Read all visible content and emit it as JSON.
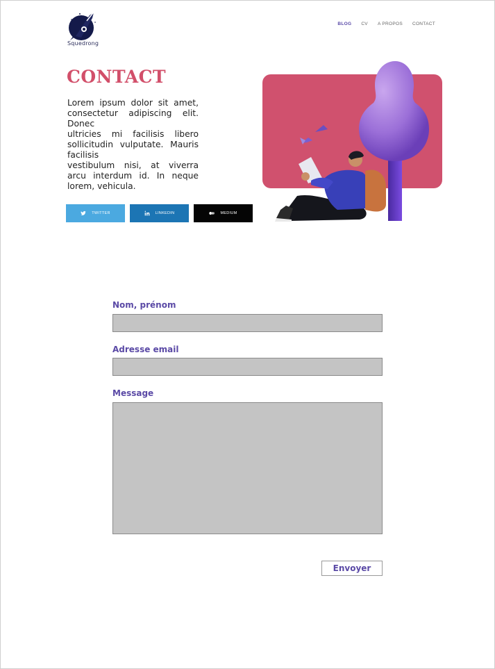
{
  "brand": {
    "name": "Squedrong"
  },
  "nav": {
    "items": [
      {
        "label": "BLOG",
        "active": true
      },
      {
        "label": "CV",
        "active": false
      },
      {
        "label": "A PROPOS",
        "active": false
      },
      {
        "label": "CONTACT",
        "active": false
      }
    ]
  },
  "header": {
    "title": "CONTACT"
  },
  "intro": {
    "lines": [
      "Lorem ipsum dolor sit amet, consectetur adipiscing elit. Donec",
      "ultricies mi facilisis libero sollicitudin vulputate. Mauris facilisis",
      "vestibulum nisi, at viverra arcu interdum id. In neque lorem, vehicula."
    ]
  },
  "socials": {
    "twitter": {
      "label": "TWITTER",
      "icon": "twitter-icon",
      "color": "#4ba9e0"
    },
    "linkedin": {
      "label": "LINKEDIN",
      "icon": "linkedin-icon",
      "color": "#1c75b4"
    },
    "medium": {
      "label": "MEDIUM",
      "icon": "medium-icon",
      "color": "#050505"
    }
  },
  "form": {
    "name_label": "Nom, prénom",
    "name_value": "",
    "email_label": "Adresse email",
    "email_value": "",
    "message_label": "Message",
    "message_value": "",
    "submit_label": "Envoyer"
  },
  "colors": {
    "accent_title": "#d24f6a",
    "accent_purple": "#5b4aa6",
    "field_bg": "#c4c4c4"
  }
}
